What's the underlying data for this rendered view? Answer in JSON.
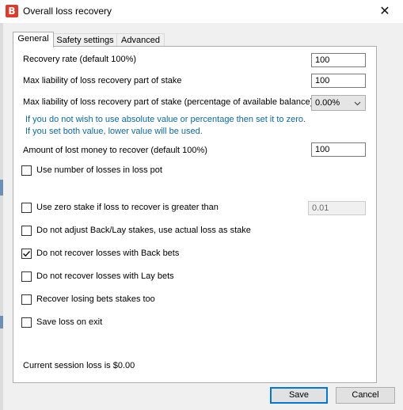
{
  "window": {
    "title": "Overall loss recovery",
    "icon_letter": "B",
    "close_glyph": "✕"
  },
  "tabs": [
    {
      "label": "General",
      "active": true
    },
    {
      "label": "Safety settings",
      "active": false
    },
    {
      "label": "Advanced",
      "active": false
    }
  ],
  "general": {
    "recovery_rate": {
      "label": "Recovery rate (default 100%)",
      "value": "100"
    },
    "max_liability": {
      "label": "Max liability of loss recovery part of stake",
      "value": "100"
    },
    "max_liability_pct": {
      "label": "Max liability of loss recovery part of stake (percentage of available balance)",
      "value": "0.00%"
    },
    "info_lines": [
      "If you do not wish to use absolute value or percentage then set it to zero.",
      "If you set both value, lower value will be used."
    ],
    "amount_lost": {
      "label": "Amount of lost money to recover (default 100%)",
      "value": "100"
    },
    "checkboxes": [
      {
        "label": "Use number of losses in loss pot",
        "checked": false
      },
      {
        "label": "Use zero stake if loss to recover is greater than",
        "checked": false
      },
      {
        "label": "Do not adjust Back/Lay stakes, use actual loss as stake",
        "checked": false
      },
      {
        "label": "Do not recover losses with Back bets",
        "checked": true
      },
      {
        "label": "Do not recover losses with Lay bets",
        "checked": false
      },
      {
        "label": "Recover losing bets stakes too",
        "checked": false
      },
      {
        "label": "Save loss on exit",
        "checked": false
      }
    ],
    "zero_stake_threshold": "0.01",
    "session_loss": "Current session loss is $0.00"
  },
  "buttons": {
    "save": "Save",
    "cancel": "Cancel"
  },
  "colors": {
    "info_text": "#0b6aa8",
    "app_icon": "#e03a2b",
    "default_button_border": "#0078d7"
  }
}
